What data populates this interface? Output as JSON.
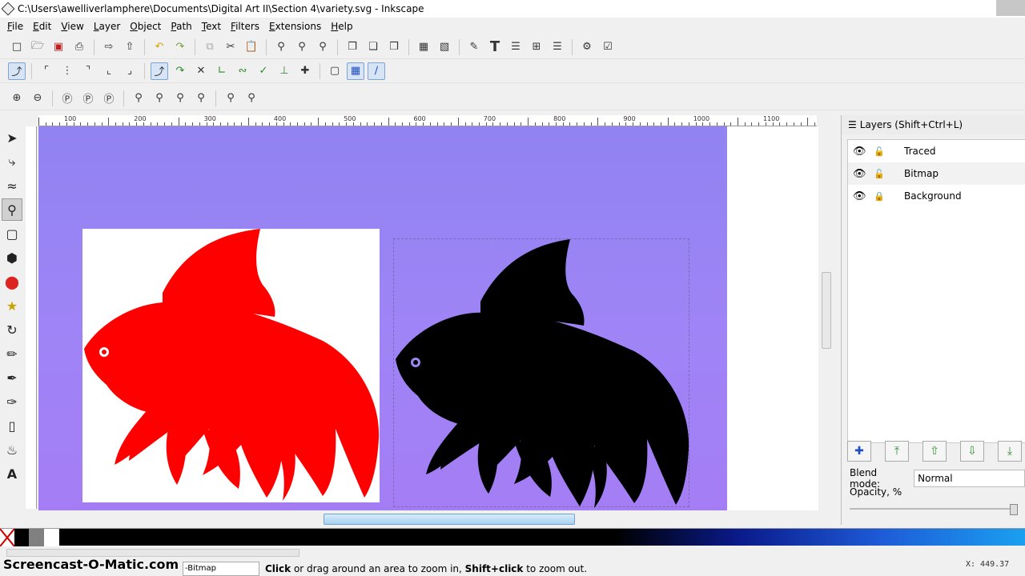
{
  "window": {
    "title": "C:\\Users\\awelliverlamphere\\Documents\\Digital Art II\\Section 4\\variety.svg - Inkscape"
  },
  "menu": [
    "File",
    "Edit",
    "View",
    "Layer",
    "Object",
    "Path",
    "Text",
    "Filters",
    "Extensions",
    "Help"
  ],
  "ruler": {
    "top_labels": [
      "100",
      "200",
      "300",
      "400",
      "500",
      "600",
      "700",
      "800",
      "900",
      "1000",
      "1100"
    ]
  },
  "layers_panel": {
    "title": "Layers (Shift+Ctrl+L)",
    "layers": [
      {
        "name": "Traced",
        "locked": false,
        "selected": false
      },
      {
        "name": "Bitmap",
        "locked": false,
        "selected": true
      },
      {
        "name": "Background",
        "locked": true,
        "selected": false
      }
    ],
    "blend_label": "Blend mode:",
    "blend_value": "Normal",
    "opacity_label": "Opacity, %",
    "opacity_value": 1.0
  },
  "palette": {
    "colors": [
      "#ffffff",
      "#000000",
      "#808080",
      "#ffffff"
    ]
  },
  "status": {
    "watermark": "Screencast-O-Matic.com",
    "current_layer": "-Bitmap",
    "message_parts": [
      "Click",
      " or drag around an area to zoom in, ",
      "Shift+click",
      " to zoom out."
    ],
    "coord_x": "X:   449.37"
  },
  "colors": {
    "fish_red": "#ff0000",
    "fish_black": "#000000",
    "page_purple": "#9c85f4"
  }
}
